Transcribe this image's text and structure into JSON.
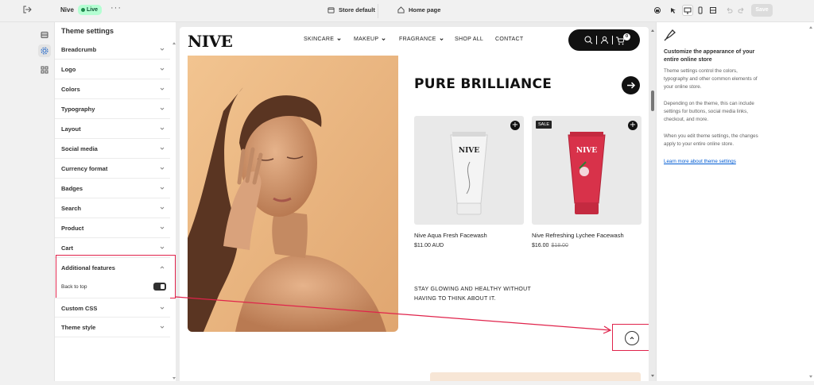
{
  "topbar": {
    "store_name": "Nive",
    "status": "Live",
    "more_label": "···",
    "theme_selector": "Store default",
    "page_selector": "Home page",
    "save_label": "Save"
  },
  "settings": {
    "title": "Theme settings",
    "items": [
      {
        "label": "Breadcrumb"
      },
      {
        "label": "Logo"
      },
      {
        "label": "Colors"
      },
      {
        "label": "Typography"
      },
      {
        "label": "Layout"
      },
      {
        "label": "Social media"
      },
      {
        "label": "Currency format"
      },
      {
        "label": "Badges"
      },
      {
        "label": "Search"
      },
      {
        "label": "Product"
      },
      {
        "label": "Cart"
      },
      {
        "label": "Additional features"
      },
      {
        "label": "Custom CSS"
      },
      {
        "label": "Theme style"
      }
    ],
    "back_to_top_label": "Back to top",
    "back_to_top_enabled": true
  },
  "store": {
    "logo": "NIVE",
    "nav": [
      "SKINCARE",
      "MAKEUP",
      "FRAGRANCE",
      "SHOP ALL",
      "CONTACT"
    ],
    "cart_count": "0",
    "heading": "PURE BRILLIANCE",
    "products": [
      {
        "name": "Nive Aqua Fresh Facewash",
        "price": "$11.00 AUD",
        "compare_price": "",
        "badge": "",
        "tube_brand": "NIVE",
        "tube_sub": "AQUA\nFRESH"
      },
      {
        "name": "Nive Refreshing Lychee Facewash",
        "price": "$16.00",
        "compare_price": "$18.00",
        "badge": "SALE",
        "tube_brand": "NIVE",
        "tube_sub": "LYCHEE"
      }
    ],
    "tagline": "STAY GLOWING AND HEALTHY WITHOUT HAVING TO THINK ABOUT IT."
  },
  "info": {
    "title": "Customize the appearance of your entire online store",
    "paragraphs": [
      "Theme settings control the colors, typography and other common elements of your online store.",
      "Depending on the theme, this can include settings for buttons, social media links, checkout, and more.",
      "When you edit theme settings, the changes apply to your entire online store."
    ],
    "link": "Learn more about theme settings"
  },
  "colors": {
    "highlight": "#e0234b",
    "live_badge": "#b4fed2",
    "link": "#005bd3"
  }
}
